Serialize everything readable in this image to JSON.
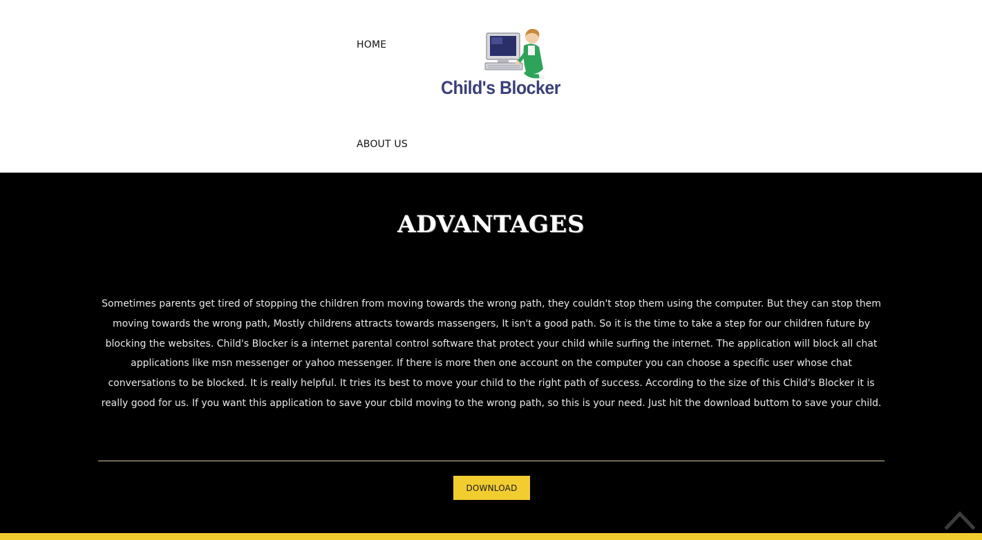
{
  "nav": {
    "home_label": "HOME",
    "about_label": "ABOUT US"
  },
  "logo": {
    "text": "Child's Blocker",
    "icon": "computer-with-child-icon"
  },
  "main": {
    "title": "ADVANTAGES",
    "description": "Sometimes parents get tired of stopping the children from moving towards the wrong path, they couldn't stop them using the computer. But they can stop them moving towards the wrong path, Mostly childrens attracts towards massengers, It isn't a good path. So it is the time to take a step for our children future by blocking the websites. Child's Blocker is a internet parental control software that protect your child while surfing the internet. The application will block all chat applications like msn messenger or yahoo messenger. If there is more then one account on the computer you can choose a specific user whose chat conversations to be blocked. It is really helpful. It tries its best to move your child to the right path of success. According to the size of this Child's Blocker it is really good for us. If you want this application to save your cbild moving to the wrong path, so this is your need. Just hit the download buttom to save your child.",
    "download_label": "DOWNLOAD"
  },
  "colors": {
    "accent": "#f2cd30",
    "header_bg": "#ffffff",
    "main_bg": "#000000",
    "logo_text": "#3a3f7a"
  },
  "icons": {
    "back_to_top": "chevron-up-icon"
  }
}
